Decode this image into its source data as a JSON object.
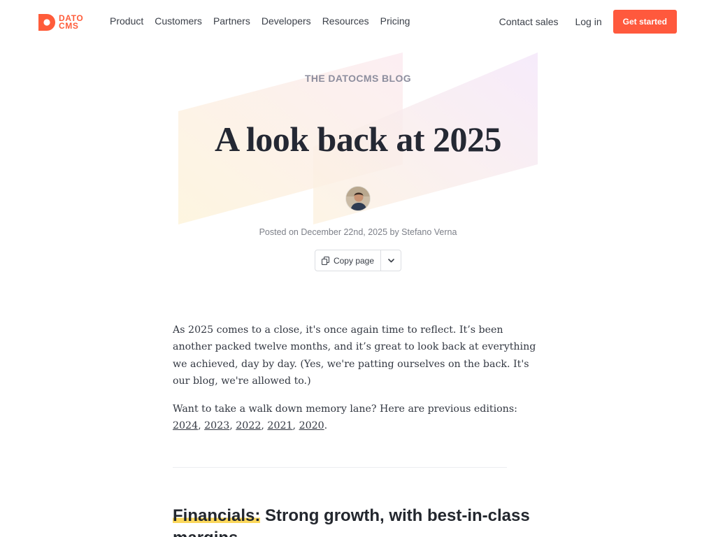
{
  "header": {
    "logo": {
      "line1": "DATO",
      "line2": "CMS",
      "color": "#ff5c3a"
    },
    "nav": [
      {
        "label": "Product"
      },
      {
        "label": "Customers"
      },
      {
        "label": "Partners"
      },
      {
        "label": "Developers"
      },
      {
        "label": "Resources"
      },
      {
        "label": "Pricing"
      }
    ],
    "contact_label": "Contact sales",
    "login_label": "Log in",
    "cta_label": "Get started",
    "cta_color": "#ff593d"
  },
  "hero": {
    "eyebrow": "THE DATOCMS BLOG",
    "title": "A look back at 2025",
    "meta": "Posted on December 22nd, 2025 by Stefano Verna",
    "copy_label": "Copy page",
    "copy_icon": "copy-icon",
    "menu_icon": "chevron-down-icon"
  },
  "article": {
    "p1": "As 2025 comes to a close, it's once again time to reflect. It’s been another packed twelve months, and it’s great to look back at everything we achieved, day by day. (Yes, we're patting ourselves on the back. It's our blog, we're allowed to.)",
    "p2_intro": "Want to take a walk down memory lane? Here are previous editions: ",
    "editions": [
      "2024",
      "2023",
      "2022",
      "2021",
      "2020"
    ],
    "section_highlight": "Financials:",
    "section_rest": " Strong growth, with best-in-class margins"
  }
}
